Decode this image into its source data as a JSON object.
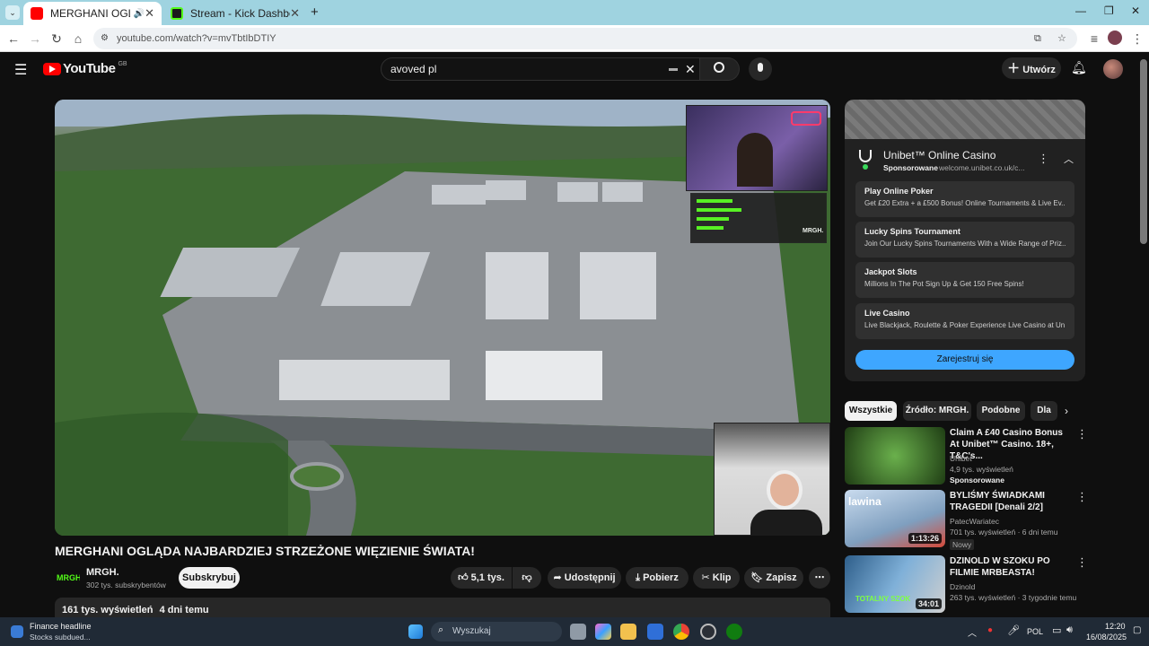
{
  "browser": {
    "tabs": [
      {
        "title": "MERGHANI OGLĄDA NAJBARDZ",
        "active": true
      },
      {
        "title": "Stream - Kick Dashboard",
        "active": false
      }
    ],
    "new_tab_symbol": "+",
    "url": "youtube.com/watch?v=mvTbtIbDTIY"
  },
  "youtube": {
    "logo_text": "YouTube",
    "region": "GB",
    "search_value": "avoved pl",
    "create_label": "Utwórz",
    "video": {
      "title": "MERGHANI OGLĄDA NAJBARDZIEJ STRZEŻONE WIĘZIENIE ŚWIATA!",
      "channel": "MRGH.",
      "subscribers": "302 tys. subskrybentów",
      "subscribe_label": "Subskrybuj",
      "likes": "5,1 tys.",
      "share_label": "Udostępnij",
      "download_label": "Pobierz",
      "clip_label": "Klip",
      "save_label": "Zapisz",
      "views": "161 tys. wyświetleń",
      "age": "4 dni temu",
      "overlay_logo": "MRGH."
    },
    "ad": {
      "name": "Unibet™ Online Casino",
      "sponsored": "Sponsorowane",
      "domain": "welcome.unibet.co.uk/c...",
      "rows": [
        {
          "title": "Play Online Poker",
          "text": "Get £20 Extra + a £500 Bonus! Online Tournaments & Live Ev..."
        },
        {
          "title": "Lucky Spins Tournament",
          "text": "Join Our Lucky Spins Tournaments With a Wide Range of Priz..."
        },
        {
          "title": "Jackpot Slots",
          "text": "Millions In The Pot Sign Up & Get 150 Free Spins!"
        },
        {
          "title": "Live Casino",
          "text": "Live Blackjack, Roulette & Poker Experience Live Casino at Un..."
        }
      ],
      "cta": "Zarejestruj się"
    },
    "chips": [
      "Wszystkie",
      "Źródło: MRGH.",
      "Podobne",
      "Dla"
    ],
    "recommendations": [
      {
        "title": "Claim A £40 Casino Bonus At Unibet™ Casino. 18+, T&C's...",
        "channel": "Unibet",
        "views": "4,9 tys. wyświetleń",
        "badge": "Sponsorowane",
        "duration": ""
      },
      {
        "title": "BYLIŚMY ŚWIADKAMI TRAGEDII [Denali 2/2]",
        "channel": "PatecWariatec",
        "views": "701 tys. wyświetleń · 6 dni temu",
        "badge": "Nowy",
        "duration": "1:13:26",
        "thumb_text": "lawina"
      },
      {
        "title": "DZINOLD W SZOKU PO FILMIE MRBEASTA!",
        "channel": "Dzinold",
        "views": "263 tys. wyświetleń · 3 tygodnie temu",
        "badge": "",
        "duration": "34:01",
        "thumb_text": "TOTALNY SZOK"
      }
    ]
  },
  "taskbar": {
    "widget_title": "Finance headline",
    "widget_sub": "Stocks subdued...",
    "search_placeholder": "Wyszukaj",
    "lang": "POL",
    "time": "12:20",
    "date": "16/08/2025"
  },
  "colors": {
    "youtube_red": "#ff0000",
    "cta_blue": "#3ea6ff",
    "tabstrip": "#9fd3e0"
  }
}
